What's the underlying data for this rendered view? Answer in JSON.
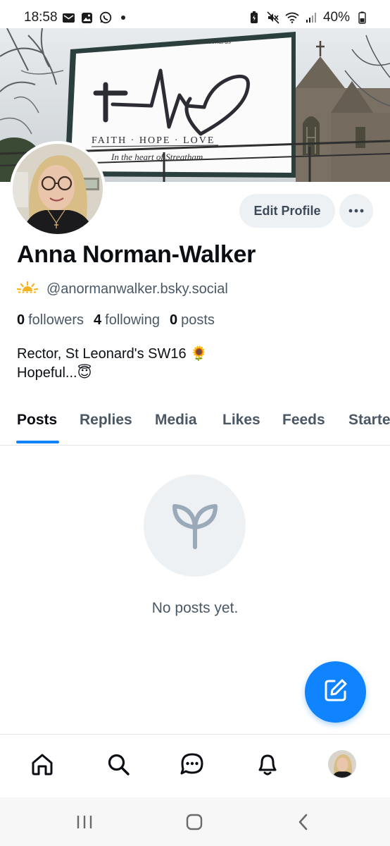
{
  "status_bar": {
    "time": "18:58",
    "battery": "40%",
    "left_icons": [
      "mail-icon",
      "gallery-icon",
      "whatsapp-icon"
    ],
    "right_icons": [
      "battery-saver-icon",
      "mute-icon",
      "wifi-icon",
      "signal-icon",
      "battery-icon"
    ]
  },
  "banner": {
    "sign_url": "www.stleonards",
    "sign_motto": "FAITH · HOPE · LOVE",
    "sign_tagline": "In the heart of Streatham"
  },
  "profile": {
    "display_name": "Anna Norman-Walker",
    "handle": "@anormanwalker.bsky.social",
    "handle_icon": "sun-icon",
    "followers_count": "0",
    "followers_label": "followers",
    "following_count": "4",
    "following_label": "following",
    "posts_count": "0",
    "posts_label": "posts",
    "bio_line1": "Rector, St Leonard's SW16 🌻",
    "bio_line2": "Hopeful...😇"
  },
  "actions": {
    "edit_profile_label": "Edit Profile",
    "more_icon": "ellipsis-icon"
  },
  "tabs": [
    {
      "label": "Posts",
      "active": true
    },
    {
      "label": "Replies",
      "active": false
    },
    {
      "label": "Media",
      "active": false
    },
    {
      "label": "Likes",
      "active": false
    },
    {
      "label": "Feeds",
      "active": false
    },
    {
      "label": "Starter Packs",
      "active": false
    }
  ],
  "empty_state": {
    "icon": "seedling-icon",
    "text": "No posts yet."
  },
  "fab": {
    "icon": "compose-icon"
  },
  "bottom_nav": [
    "home-icon",
    "search-icon",
    "chat-icon",
    "bell-icon",
    "profile-avatar"
  ],
  "system_nav": [
    "recents-icon",
    "home-button-icon",
    "back-icon"
  ],
  "colors": {
    "accent": "#1083fe",
    "text_primary": "#0b0f14",
    "text_secondary": "#4a5866",
    "button_bg": "#eef1f4"
  }
}
